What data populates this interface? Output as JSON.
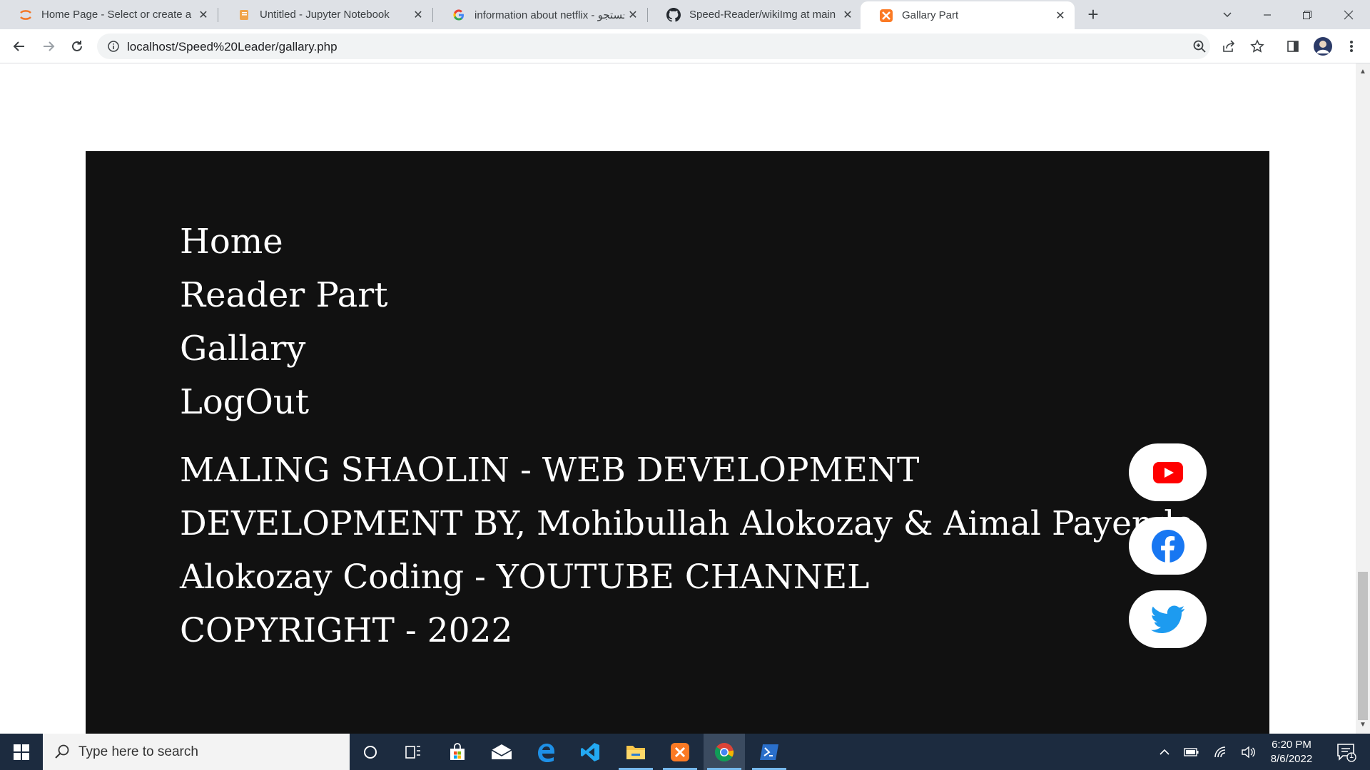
{
  "browser": {
    "tabs": [
      {
        "title": "Home Page - Select or create a n",
        "icon": "jupyter-icon"
      },
      {
        "title": "Untitled - Jupyter Notebook",
        "icon": "notebook-icon"
      },
      {
        "title": "information about netflix - جستجو",
        "icon": "google-icon"
      },
      {
        "title": "Speed-Reader/wikiImg at main · ",
        "icon": "github-icon"
      },
      {
        "title": "Gallary Part",
        "icon": "xampp-icon"
      }
    ],
    "url": "localhost/Speed%20Leader/gallary.php"
  },
  "footer": {
    "links": [
      "Home",
      "Reader Part",
      "Gallary",
      "LogOut"
    ],
    "info": [
      "MALING SHAOLIN - WEB DEVELOPMENT",
      "DEVELOPMENT BY, Mohibullah Alokozay & Aimal Payenda",
      "Alokozay Coding - YOUTUBE CHANNEL",
      "COPYRIGHT - 2022"
    ],
    "social": [
      "youtube-icon",
      "facebook-icon",
      "twitter-icon"
    ]
  },
  "taskbar": {
    "search_placeholder": "Type here to search",
    "time": "6:20 PM",
    "date": "8/6/2022",
    "notification_count": "1"
  },
  "colors": {
    "footer_bg": "#111111",
    "youtube": "#ff0000",
    "facebook": "#1877f2",
    "twitter": "#1d9bf0",
    "taskbar": "#1c2b3f"
  }
}
